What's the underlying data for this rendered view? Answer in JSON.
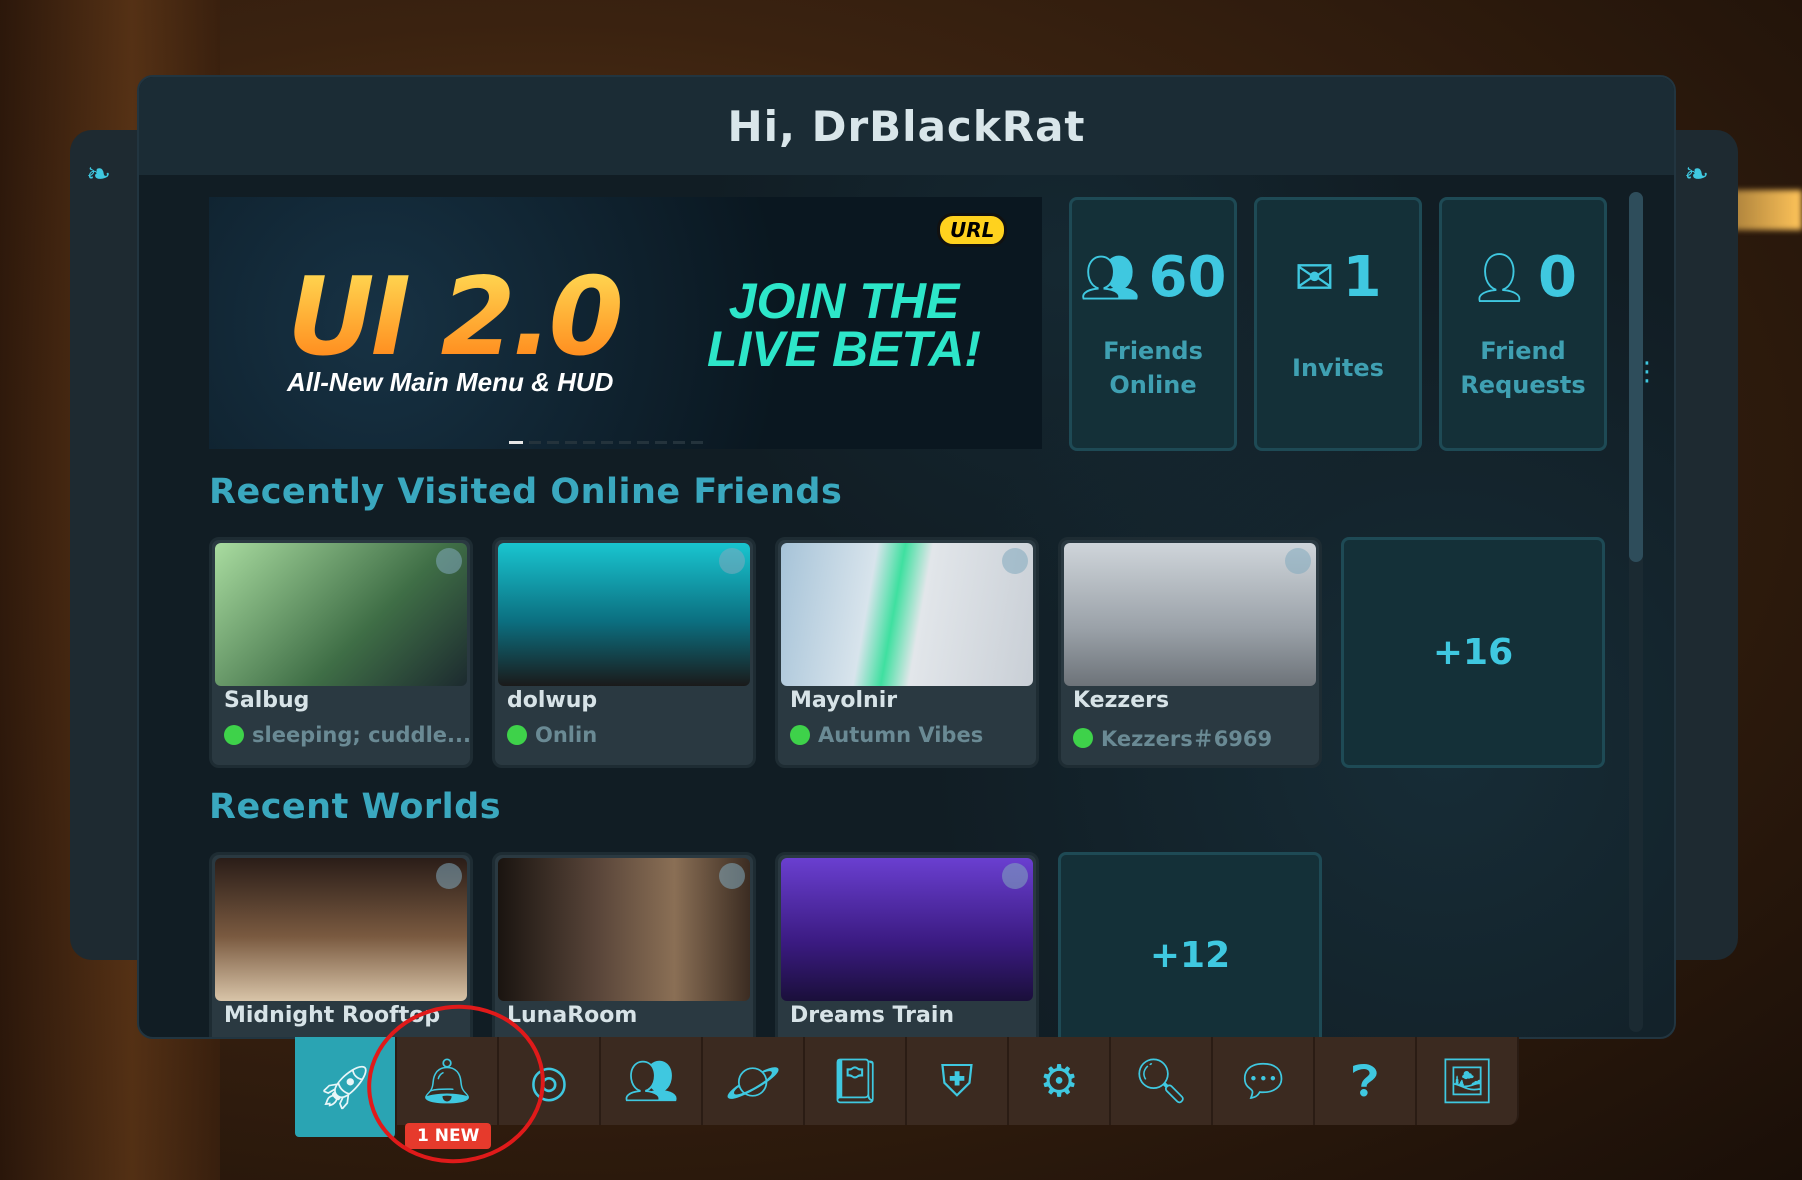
{
  "header": {
    "greeting": "Hi, DrBlackRat"
  },
  "banner": {
    "headline": "UI 2.0",
    "subheadline": "All-New Main Menu & HUD",
    "cta_line1": "JOIN THE",
    "cta_line2": "LIVE BETA!",
    "url_badge": "URL"
  },
  "stats": [
    {
      "icon": "friends-icon",
      "value": "60",
      "label_line1": "Friends",
      "label_line2": "Online"
    },
    {
      "icon": "envelope-icon",
      "value": "1",
      "label_line1": "Invites",
      "label_line2": ""
    },
    {
      "icon": "add-friend-icon",
      "value": "0",
      "label_line1": "Friend",
      "label_line2": "Requests"
    }
  ],
  "friends_section": {
    "title": "Recently Visited Online Friends",
    "friends": [
      {
        "name": "Salbug",
        "status": "sleeping; cuddle...",
        "thumb_color": "#5e8a5a"
      },
      {
        "name": "dolwup",
        "status": "Onlin",
        "thumb_color": "#1ba6b0"
      },
      {
        "name": "Mayolnir",
        "status": "Autumn Vibes",
        "thumb_color": "#b9c7d4"
      },
      {
        "name": "Kezzers",
        "status": "Kezzers＃6969",
        "thumb_color": "#8e949a"
      }
    ],
    "more": "+16"
  },
  "worlds_section": {
    "title": "Recent Worlds",
    "worlds": [
      {
        "name": "Midnight Rooftop",
        "thumb_color": "#3b2a22"
      },
      {
        "name": "LunaRoom",
        "thumb_color": "#4a3a2e"
      },
      {
        "name": "Dreams Train",
        "thumb_color": "#4b2a8a"
      }
    ],
    "more": "+12"
  },
  "nav": {
    "items": [
      "rocket-icon",
      "bell-icon",
      "profile-icon",
      "group-icon",
      "planet-icon",
      "notebook-icon",
      "shield-icon",
      "gear-icon",
      "search-icon",
      "chat-add-icon",
      "help-icon",
      "gallery-icon"
    ],
    "notification_badge": "1 NEW"
  },
  "colors": {
    "accent": "#3fc8e0",
    "online": "#3ed24a",
    "badge": "#e63a2c"
  }
}
